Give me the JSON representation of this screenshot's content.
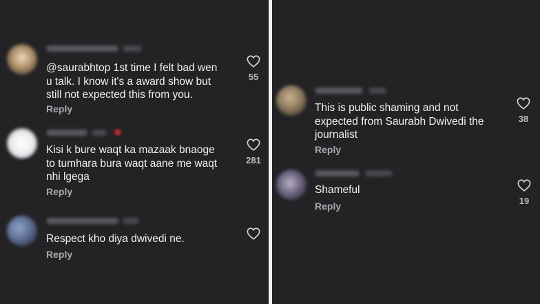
{
  "left_panel": {
    "comments": [
      {
        "text": "@saurabhtop 1st time I felt bad wen\nu talk. I know it's a award show but\nstill not expected this from you.",
        "reply_label": "Reply",
        "likes": "55"
      },
      {
        "text": "Kisi k bure waqt ka mazaak bnaoge\nto tumhara bura waqt aane me waqt\nnhi lgega",
        "reply_label": "Reply",
        "likes": "281"
      },
      {
        "text": "Respect kho diya dwivedi ne.",
        "reply_label": "Reply",
        "likes": ""
      }
    ]
  },
  "right_panel": {
    "comments": [
      {
        "text": "This is public shaming and not\nexpected from Saurabh Dwivedi the\njournalist",
        "reply_label": "Reply",
        "likes": "38"
      },
      {
        "text": "Shameful",
        "reply_label": "Reply",
        "likes": "19"
      }
    ]
  },
  "colors": {
    "background": "#232326",
    "text": "#f2f2f2",
    "secondary_text": "#a8a8ad",
    "divider": "#f0f0f0"
  },
  "icons": [
    "heart-icon"
  ]
}
